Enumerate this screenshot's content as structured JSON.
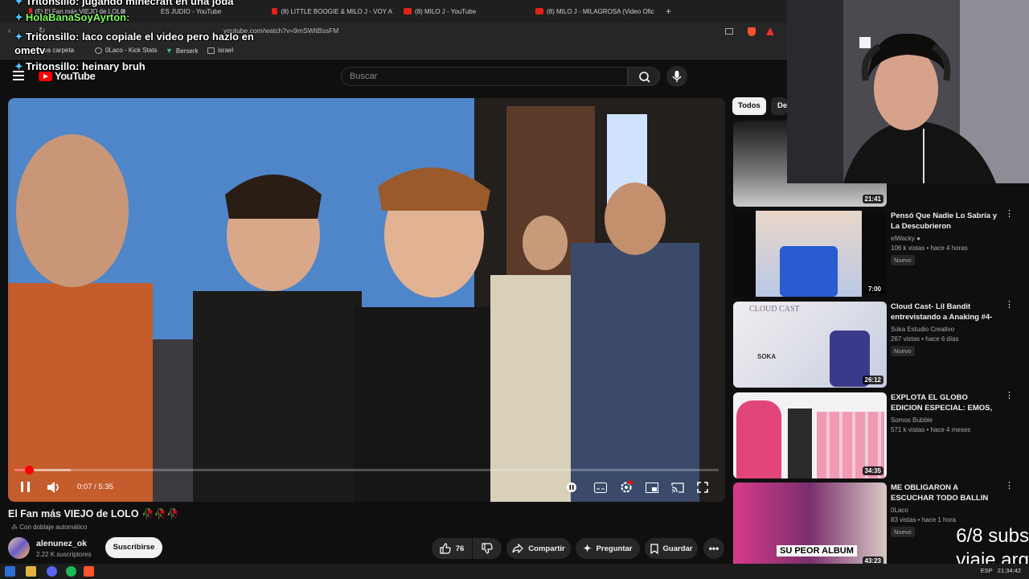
{
  "browser": {
    "tabs": [
      {
        "title": "(5) El Fan más VIEJO de LOLO",
        "active": true
      },
      {
        "title": "ES JUDIO - YouTube"
      },
      {
        "title": "(8) LITTLE BOOGIE & MILO J - VOY A"
      },
      {
        "title": "(8) MILO J - YouTube"
      },
      {
        "title": "(8) MILO J - MILAGROSA (Video Ofic"
      }
    ],
    "new_tab": "+",
    "url": "youtube.com/watch?v=9mSWltBssFM",
    "bookmarks": [
      "Nueva carpeta",
      "0Laco - Kick Stats",
      "Berserk",
      "israel"
    ]
  },
  "chat": [
    {
      "user": "Tritonsillo:",
      "message": "jugando minecraft en una joda"
    },
    {
      "user": "HolaBanaSoyAyrton:",
      "message": ""
    },
    {
      "user": "Tritonsillo:",
      "message": "laco copiale el video pero hazlo en"
    },
    {
      "user": "",
      "message": "ometv"
    },
    {
      "user": "Tritonsillo:",
      "message": "heinary bruh"
    }
  ],
  "youtube": {
    "logo_text": "YouTube",
    "search_placeholder": "Buscar"
  },
  "player": {
    "time": "0:07 / 5:35",
    "progress_fraction": 0.021,
    "buffered_fraction": 0.08
  },
  "video": {
    "title": "El Fan más VIEJO de LOLO",
    "title_emoji": "🥀🥀🥀",
    "dubbing": "Con doblaje automático",
    "channel": "alenunez_ok",
    "subscribers": "2.22 K suscriptores",
    "subscribe_label": "Suscribirse",
    "likes": "76",
    "share_label": "Compartir",
    "ask_label": "Preguntar",
    "save_label": "Guardar"
  },
  "sidebar": {
    "chips": [
      "Todos",
      "De"
    ],
    "recommendations": [
      {
        "title": "",
        "channel": "",
        "meta": "",
        "badge": "",
        "duration": "21:41"
      },
      {
        "title": "Pensó Que Nadie Lo Sabría y La Descubrieron",
        "channel": "elWacky",
        "meta": "106 k vistas • hace 4 horas",
        "badge": "Nuevo",
        "duration": "7:00"
      },
      {
        "title": "Cloud Cast- Lil Bandit entrevistando a Anaking #4- ...",
        "channel": "Soka Estudio Creativo",
        "meta": "267 vistas • hace 6 días",
        "badge": "Nuevo",
        "duration": "26:12"
      },
      {
        "title": "EXPLOTA EL GLOBO EDICION ESPECIAL: EMOS, OTAKUS, ...",
        "channel": "Somos Bubble",
        "meta": "571 k vistas • hace 4 meses",
        "badge": "",
        "duration": "34:35"
      },
      {
        "title": "ME OBLIGARON A ESCUCHAR TODO BALLIN DE VERDAD...",
        "channel": "0Laco",
        "meta": "83 vistas • hace 1 hora",
        "badge": "Nuevo",
        "duration": "43:23"
      }
    ]
  },
  "thumb_text": {
    "cloud_cast": "CLOUD CAST",
    "soka": "SOKA",
    "su_peor_album": "SU PEOR ALBUM"
  },
  "overlay": {
    "subgoal_line1": "6/8 subs",
    "subgoal_line2": "viaje arg"
  },
  "taskbar": {
    "lang": "ESP",
    "clock": "21:34:42"
  },
  "colors": {
    "accent": "#ff0000",
    "background": "#0f0f0f",
    "chip_active": "#f1f1f1"
  }
}
